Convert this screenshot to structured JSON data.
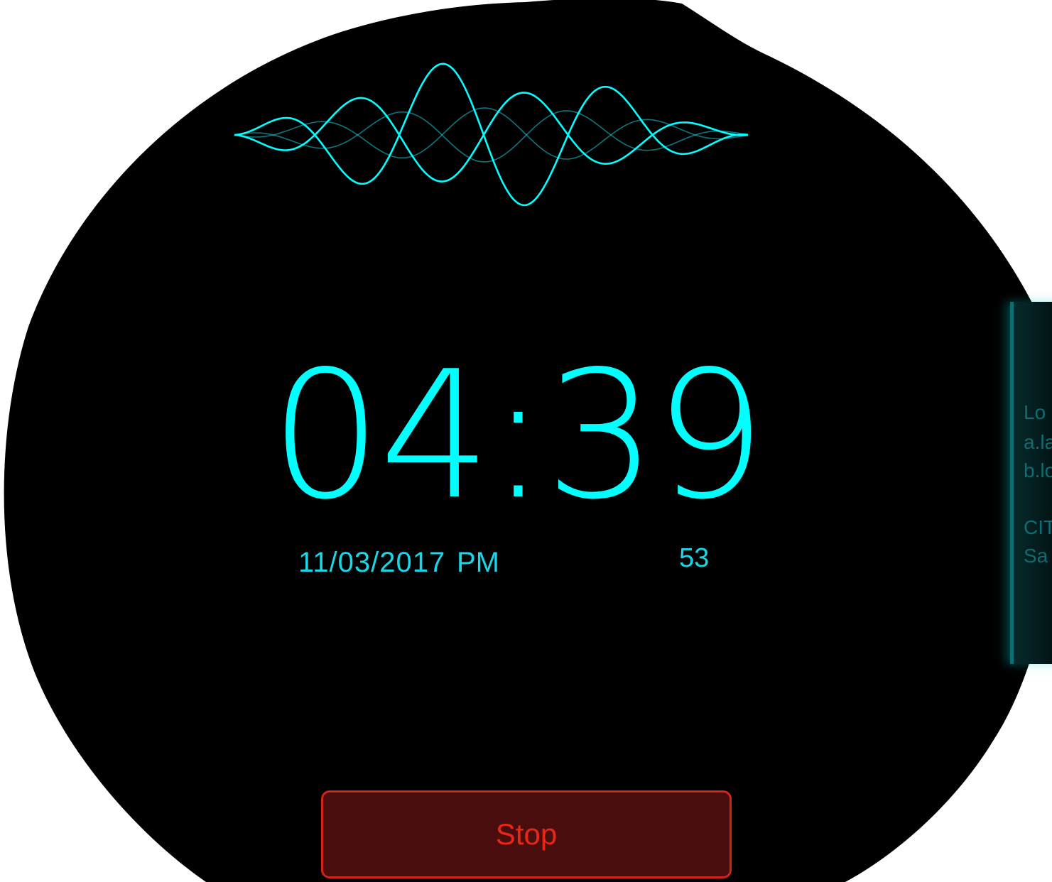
{
  "clock": {
    "time": "04:39",
    "date": "11/03/2017",
    "ampm": "PM",
    "seconds": "53"
  },
  "side_panel": {
    "lines": [
      "Lo",
      "a.la",
      "b.lo",
      "CIT",
      "Sa"
    ]
  },
  "controls": {
    "stop_label": "Stop"
  },
  "colors": {
    "accent": "#00ffff",
    "accent_dim": "#1ad6e6",
    "stop_border": "#d2231a",
    "stop_fill": "#4a0d0d",
    "stop_text": "#e52718",
    "background": "#000000"
  }
}
